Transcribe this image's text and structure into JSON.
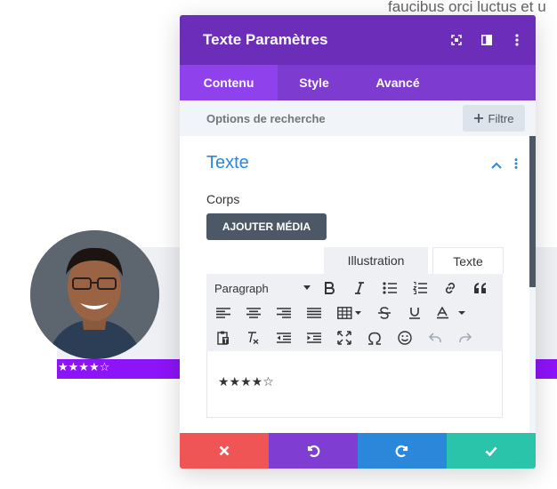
{
  "background": {
    "snippet_text": "faucibus orci luctus et u",
    "rating_stars": "★★★★☆",
    "accent_color": "#8d13f8"
  },
  "modal": {
    "title": "Texte Paramètres",
    "header_color": "#6c2eb9",
    "tabs": [
      {
        "label": "Contenu",
        "active": true
      },
      {
        "label": "Style",
        "active": false
      },
      {
        "label": "Avancé",
        "active": false
      }
    ],
    "search": {
      "placeholder": "Options de recherche",
      "filter_label": "Filtre"
    },
    "section": {
      "title": "Texte",
      "accent_color": "#2b87da"
    },
    "body_label": "Corps",
    "add_media_label": "AJOUTER MÉDIA",
    "editor_tabs": [
      {
        "label": "Illustration",
        "active": false
      },
      {
        "label": "Texte",
        "active": true
      }
    ],
    "toolbar": {
      "format_value": "Paragraph"
    },
    "editor_content": "★★★★☆",
    "footer_colors": {
      "cancel": "#ef5555",
      "undo": "#7f3dd2",
      "redo": "#2b87da",
      "save": "#29c4a9"
    }
  }
}
